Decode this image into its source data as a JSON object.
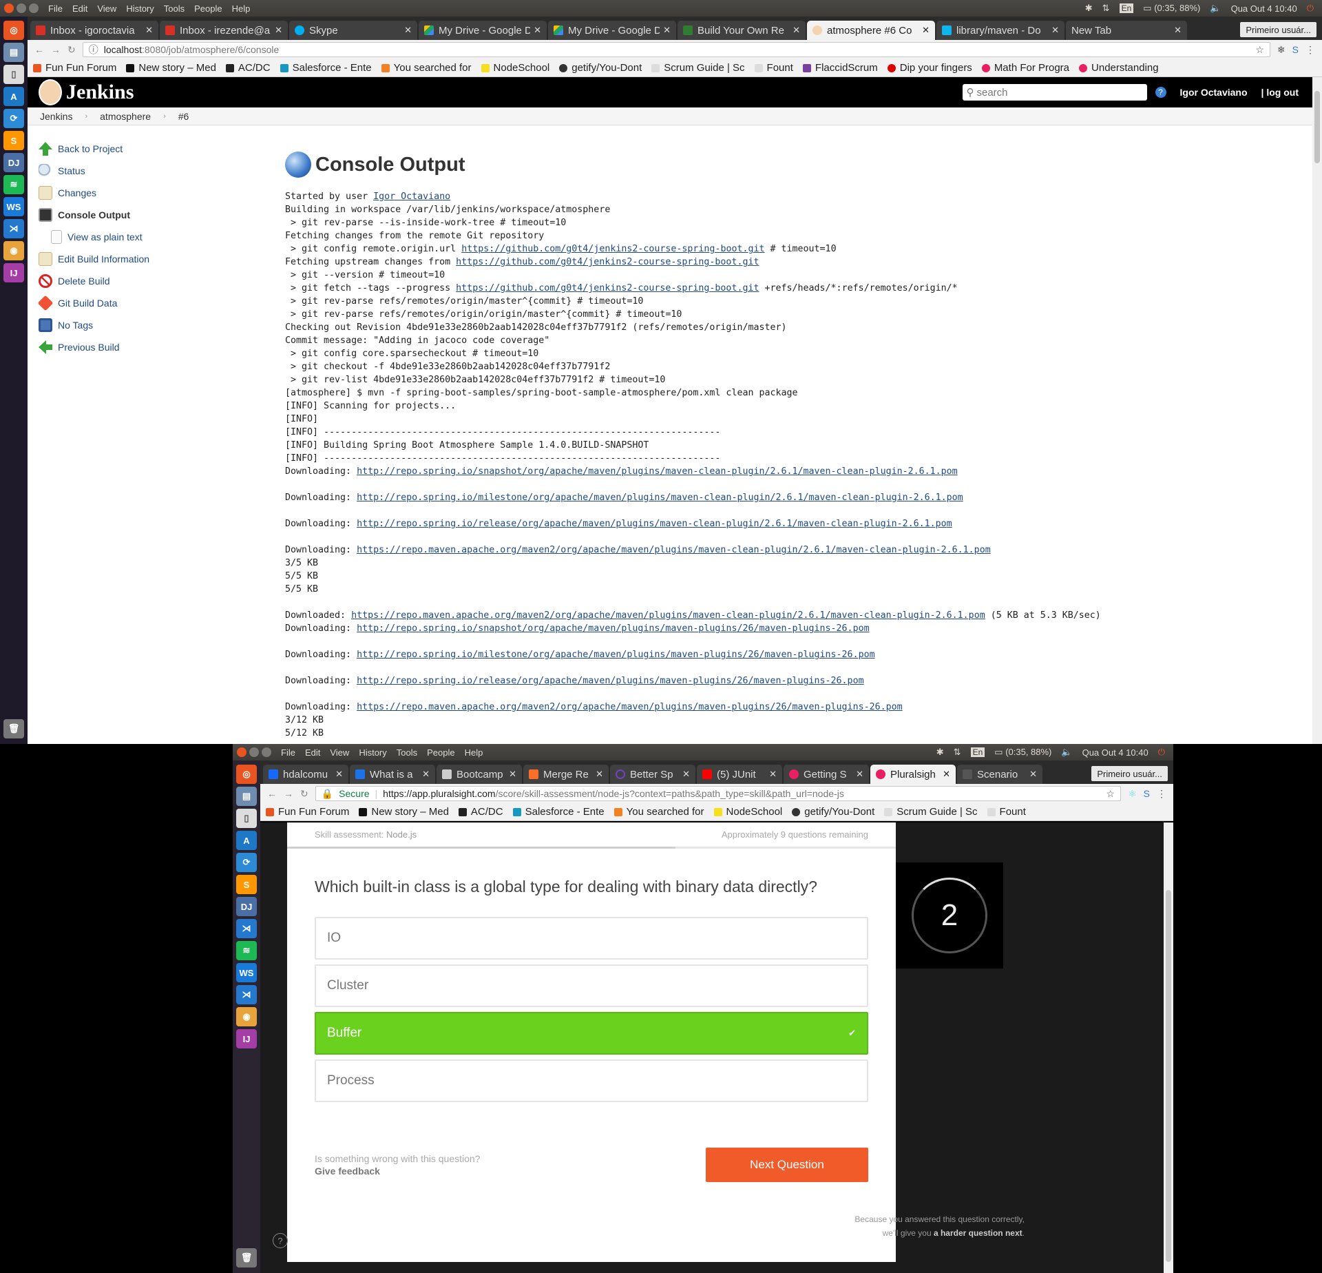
{
  "screen1": {
    "system": {
      "menu": [
        "File",
        "Edit",
        "View",
        "History",
        "Tools",
        "People",
        "Help"
      ],
      "lang": "En",
      "battery": "(0:35, 88%)",
      "clock": "Qua Out  4 10:40"
    },
    "tabs": [
      {
        "label": "Inbox - igoroctavia",
        "color": "#d93025"
      },
      {
        "label": "Inbox - irezende@a",
        "color": "#d93025"
      },
      {
        "label": "Skype",
        "color": "#00aff0"
      },
      {
        "label": "My Drive - Google D",
        "color": "#1fa463"
      },
      {
        "label": "My Drive - Google D",
        "color": "#1fa463"
      },
      {
        "label": "Build Your Own Re",
        "color": "#2e7d32"
      },
      {
        "label": "atmosphere #6 Co",
        "color": "#c0392b"
      },
      {
        "label": "library/maven - Do",
        "color": "#0db7ed"
      },
      {
        "label": "New Tab",
        "color": ""
      }
    ],
    "profile": "Primeiro usuár...",
    "url_host": "localhost",
    "url_rest": ":8080/job/atmosphere/6/console",
    "bookmarks": [
      {
        "label": "Fun Fun Forum",
        "color": "#e95420"
      },
      {
        "label": "New story – Med",
        "color": "#111"
      },
      {
        "label": "AC/DC",
        "color": "#222"
      },
      {
        "label": "Salesforce - Ente",
        "color": "#1798c1"
      },
      {
        "label": "You searched for",
        "color": "#f48024"
      },
      {
        "label": "NodeSchool",
        "color": "#f7df1e"
      },
      {
        "label": "getify/You-Dont",
        "color": "#333"
      },
      {
        "label": "Scrum Guide | Sc",
        "color": "#bbb"
      },
      {
        "label": "Fount",
        "color": "#bbb"
      },
      {
        "label": "FlaccidScrum",
        "color": "#7b3fa0"
      },
      {
        "label": "Dip your fingers",
        "color": "#d00"
      },
      {
        "label": "Math For Progra",
        "color": "#e91e63"
      },
      {
        "label": "Understanding",
        "color": "#e91e63"
      }
    ],
    "jenkins": {
      "brand": "Jenkins",
      "search_placeholder": "search",
      "user": "Igor Octaviano",
      "logout": "| log out",
      "breadcrumb": [
        "Jenkins",
        "atmosphere",
        "#6"
      ],
      "sidebar": [
        {
          "label": "Back to Project",
          "icon": "arrow-up-icon",
          "color": "#3aa33a"
        },
        {
          "label": "Status",
          "icon": "magnifier-icon",
          "color": "#8aa1c0"
        },
        {
          "label": "Changes",
          "icon": "notepad-icon",
          "color": "#c8b27a"
        },
        {
          "label": "Console Output",
          "icon": "terminal-icon",
          "color": "#333"
        },
        {
          "label": "View as plain text",
          "icon": "document-icon",
          "color": "#ddd"
        },
        {
          "label": "Edit Build Information",
          "icon": "notepad-edit-icon",
          "color": "#c8b27a"
        },
        {
          "label": "Delete Build",
          "icon": "no-entry-icon",
          "color": "#d22"
        },
        {
          "label": "Git Build Data",
          "icon": "git-icon",
          "color": "#f05033"
        },
        {
          "label": "No Tags",
          "icon": "save-icon",
          "color": "#4a76b8"
        },
        {
          "label": "Previous Build",
          "icon": "arrow-left-icon",
          "color": "#3aa33a"
        }
      ],
      "title": "Console Output"
    }
  },
  "screen2": {
    "system": {
      "menu": [
        "File",
        "Edit",
        "View",
        "History",
        "Tools",
        "People",
        "Help"
      ],
      "lang": "En",
      "battery": "(0:35, 88%)",
      "clock": "Qua Out  4 10:40"
    },
    "tabs": [
      {
        "label": "hdalcomu",
        "color": "#1769ff"
      },
      {
        "label": "What is a",
        "color": "#1a73e8"
      },
      {
        "label": "Bootcamp",
        "color": "#ccc"
      },
      {
        "label": "Merge Re",
        "color": "#fc6d26"
      },
      {
        "label": "Better Sp",
        "color": "#6f42c1"
      },
      {
        "label": "(5) JUnit",
        "color": "#f00"
      },
      {
        "label": "Getting S",
        "color": "#e91e63"
      },
      {
        "label": "Pluralsigh",
        "color": "#e91e63"
      },
      {
        "label": "Scenario",
        "color": "#555"
      }
    ],
    "profile": "Primeiro usuár...",
    "secure": "Secure",
    "url_host": "https://app.pluralsight.com",
    "url_rest": "/score/skill-assessment/node-js?context=paths&path_type=skill&path_url=node-js",
    "bookmarks": [
      {
        "label": "Fun Fun Forum",
        "color": "#e95420"
      },
      {
        "label": "New story – Med",
        "color": "#111"
      },
      {
        "label": "AC/DC",
        "color": "#222"
      },
      {
        "label": "Salesforce - Ente",
        "color": "#1798c1"
      },
      {
        "label": "You searched for",
        "color": "#f48024"
      },
      {
        "label": "NodeSchool",
        "color": "#f7df1e"
      },
      {
        "label": "getify/You-Dont",
        "color": "#333"
      },
      {
        "label": "Scrum Guide | Sc",
        "color": "#bbb"
      },
      {
        "label": "Fount",
        "color": "#bbb"
      }
    ],
    "quiz": {
      "assessment_prefix": "Skill assessment:",
      "assessment_name": "Node.js",
      "remaining": "Approximately 9 questions remaining",
      "question": "Which built-in class is a global type for dealing with binary data directly?",
      "options": [
        "IO",
        "Cluster",
        "Buffer",
        "Process"
      ],
      "selected": "Buffer",
      "feedback_q": "Is something wrong with this question?",
      "feedback_link": "Give feedback",
      "next": "Next Question",
      "timer": "2",
      "note_line1": "Because you answered this question correctly,",
      "note_line2_a": "we'll give you ",
      "note_line2_b": "a harder question next",
      "note_line2_c": "."
    }
  }
}
